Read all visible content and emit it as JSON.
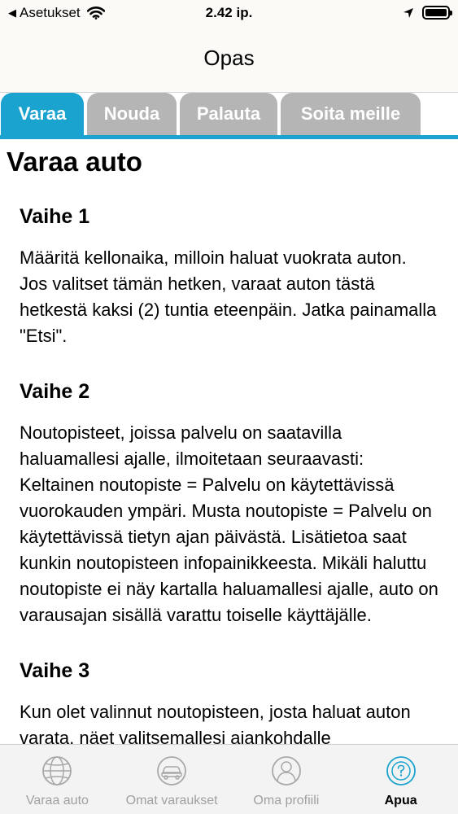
{
  "status_bar": {
    "back_label": "Asetukset",
    "time": "2.42 ip."
  },
  "nav": {
    "title": "Opas"
  },
  "segment_tabs": [
    {
      "label": "Varaa",
      "active": true
    },
    {
      "label": "Nouda",
      "active": false
    },
    {
      "label": "Palauta",
      "active": false
    },
    {
      "label": "Soita meille",
      "active": false
    }
  ],
  "content": {
    "heading": "Varaa auto",
    "steps": [
      {
        "title": "Vaihe 1",
        "body": "Määritä kellonaika, milloin haluat vuokrata auton. Jos valitset tämän hetken, varaat auton tästä hetkestä kaksi (2) tuntia eteenpäin. Jatka painamalla \"Etsi\"."
      },
      {
        "title": "Vaihe 2",
        "body": "Noutopisteet, joissa palvelu on saatavilla haluamallesi ajalle, ilmoitetaan seuraavasti: Keltainen noutopiste = Palvelu on käytettävissä vuorokauden ympäri. Musta noutopiste = Palvelu on käytettävissä tietyn ajan päivästä. Lisätietoa saat kunkin noutopisteen infopainikkeesta. Mikäli haluttu noutopiste ei näy kartalla haluamallesi ajalle, auto on varausajan sisällä varattu toiselle käyttäjälle."
      },
      {
        "title": "Vaihe 3",
        "body": "Kun olet valinnut noutopisteen, josta haluat auton varata, näet valitsemallesi ajankohdalle"
      }
    ]
  },
  "tab_bar": [
    {
      "label": "Varaa auto",
      "icon": "globe-icon",
      "active": false
    },
    {
      "label": "Omat varaukset",
      "icon": "car-icon",
      "active": false
    },
    {
      "label": "Oma profiili",
      "icon": "person-icon",
      "active": false
    },
    {
      "label": "Apua",
      "icon": "help-icon",
      "active": true
    }
  ],
  "colors": {
    "accent": "#1aa3cf",
    "inactive_tab": "#b5b5b5",
    "tab_bar_inactive_text": "#a0a0a0"
  }
}
